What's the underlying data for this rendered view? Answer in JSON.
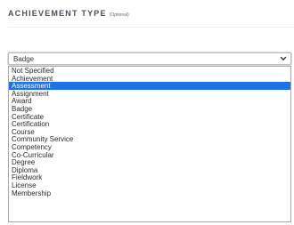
{
  "section": {
    "title": "ACHIEVEMENT TYPE",
    "optional_label": "(Optional)"
  },
  "select": {
    "value": "Badge",
    "icon": "chevron-down-icon"
  },
  "options": [
    {
      "label": "Not Specified",
      "highlighted": false
    },
    {
      "label": "Achievement",
      "highlighted": false
    },
    {
      "label": "Assessment",
      "highlighted": true
    },
    {
      "label": "Assignment",
      "highlighted": false
    },
    {
      "label": "Award",
      "highlighted": false
    },
    {
      "label": "Badge",
      "highlighted": false
    },
    {
      "label": "Certificate",
      "highlighted": false
    },
    {
      "label": "Certification",
      "highlighted": false
    },
    {
      "label": "Course",
      "highlighted": false
    },
    {
      "label": "Community Service",
      "highlighted": false
    },
    {
      "label": "Competency",
      "highlighted": false
    },
    {
      "label": "Co-Curricular",
      "highlighted": false
    },
    {
      "label": "Degree",
      "highlighted": false
    },
    {
      "label": "Diploma",
      "highlighted": false
    },
    {
      "label": "Fieldwork",
      "highlighted": false
    },
    {
      "label": "License",
      "highlighted": false
    },
    {
      "label": "Membership",
      "highlighted": false
    }
  ],
  "colors": {
    "highlight": "#1e73e8",
    "heading": "#4a4f57"
  }
}
